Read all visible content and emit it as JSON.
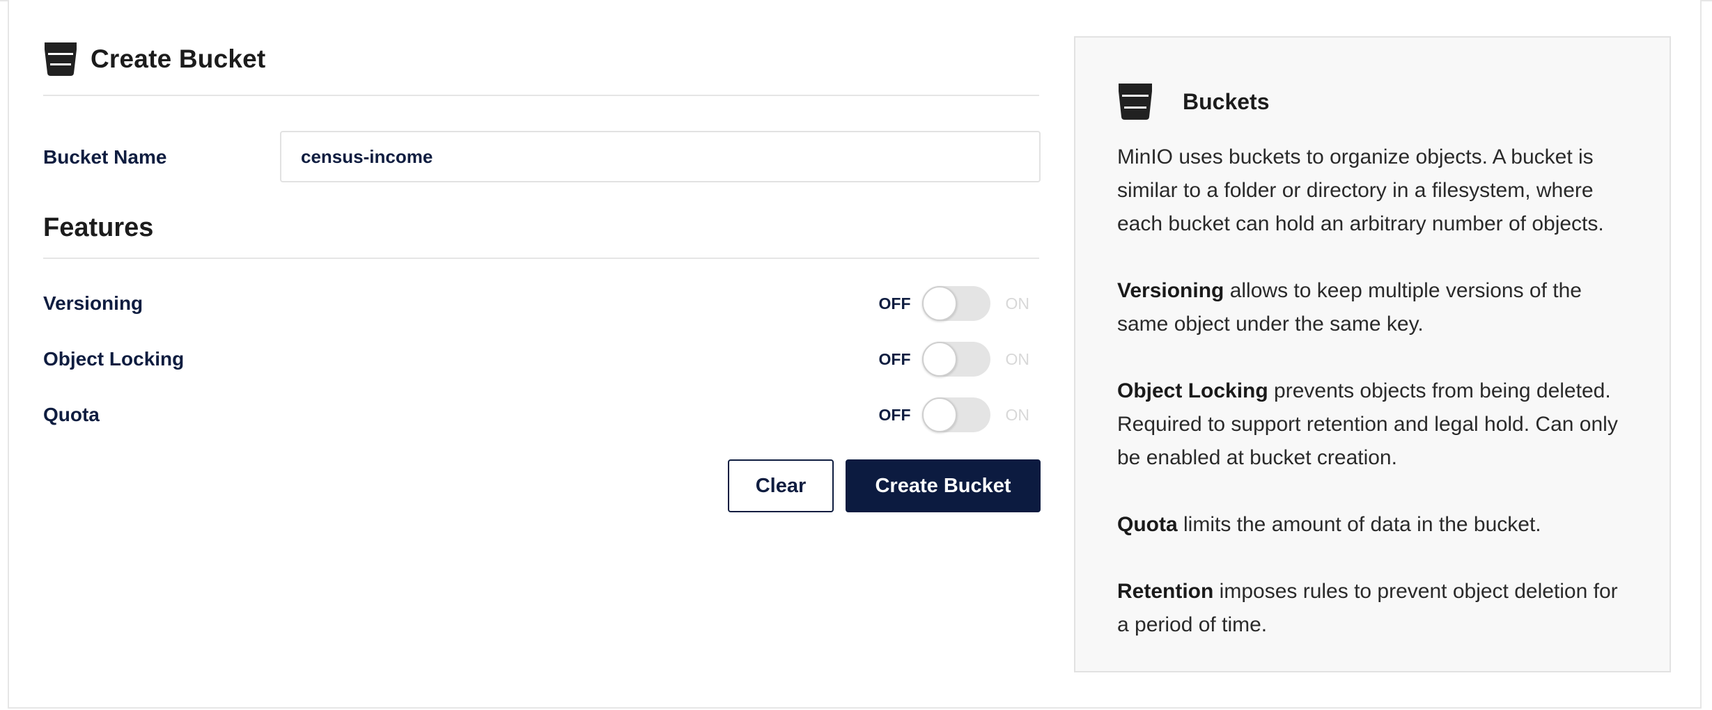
{
  "form": {
    "title": "Create Bucket",
    "bucket_name_label": "Bucket Name",
    "bucket_name_value": "census-income",
    "features_title": "Features",
    "features": [
      {
        "label": "Versioning",
        "off_label": "OFF",
        "on_label": "ON",
        "enabled": false
      },
      {
        "label": "Object Locking",
        "off_label": "OFF",
        "on_label": "ON",
        "enabled": false
      },
      {
        "label": "Quota",
        "off_label": "OFF",
        "on_label": "ON",
        "enabled": false
      }
    ],
    "clear_label": "Clear",
    "create_label": "Create Bucket"
  },
  "help": {
    "title": "Buckets",
    "intro": "MinIO uses buckets to organize objects. A bucket is similar to a folder or directory in a filesystem, where each bucket can hold an arbitrary number of objects.",
    "items": [
      {
        "term": "Versioning",
        "text": " allows to keep multiple versions of the same object under the same key."
      },
      {
        "term": "Object Locking",
        "text": " prevents objects from being deleted. Required to support retention and legal hold. Can only be enabled at bucket creation."
      },
      {
        "term": "Quota",
        "text": " limits the amount of data in the bucket."
      },
      {
        "term": "Retention",
        "text": " imposes rules to prevent object deletion for a period of time."
      }
    ]
  },
  "icons": {
    "bucket": "bucket-icon",
    "primary_color": "#0c1b40",
    "icon_color": "#212121"
  }
}
